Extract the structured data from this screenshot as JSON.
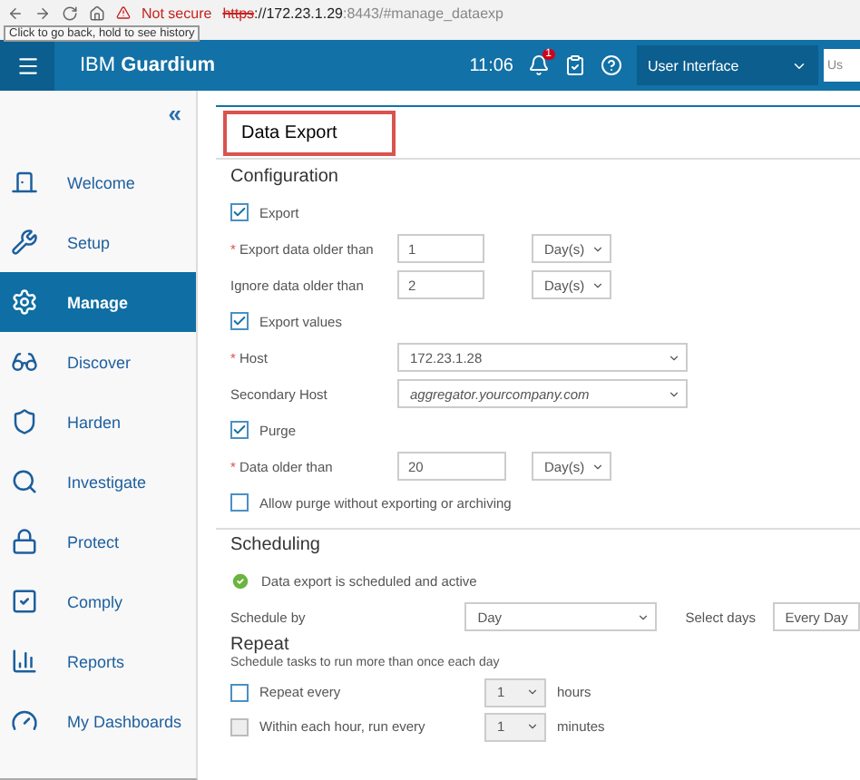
{
  "browser": {
    "warning": "Not secure",
    "url_scheme": "https",
    "url_host": "://172.23.1.29",
    "url_rest": ":8443/#manage_dataexp",
    "tooltip": "Click to go back, hold to see history"
  },
  "header": {
    "brand_prefix": "IBM",
    "brand_name": "Guardium",
    "time": "11:06",
    "notification_count": "1",
    "role_select": "User Interface",
    "search_partial": "Us"
  },
  "sidebar": {
    "collapse": "«",
    "items": [
      {
        "label": "Welcome",
        "selected": false
      },
      {
        "label": "Setup",
        "selected": false
      },
      {
        "label": "Manage",
        "selected": true
      },
      {
        "label": "Discover",
        "selected": false
      },
      {
        "label": "Harden",
        "selected": false
      },
      {
        "label": "Investigate",
        "selected": false
      },
      {
        "label": "Protect",
        "selected": false
      },
      {
        "label": "Comply",
        "selected": false
      },
      {
        "label": "Reports",
        "selected": false
      },
      {
        "label": "My Dashboards",
        "selected": false
      }
    ]
  },
  "content": {
    "title": "Data Export",
    "configuration": {
      "heading": "Configuration",
      "required_mark": "*",
      "rows": [
        {
          "kind": "checkbox",
          "label": "Export",
          "checked": true
        },
        {
          "kind": "number",
          "label": "Export data older than",
          "required": true,
          "value": "1",
          "unit": "Day(s)"
        },
        {
          "kind": "number",
          "label": "Ignore data older than",
          "required": false,
          "value": "2",
          "unit": "Day(s)"
        },
        {
          "kind": "checkbox",
          "label": "Export values",
          "checked": true
        },
        {
          "kind": "select",
          "label": "Host",
          "required": true,
          "value": "172.23.1.28"
        },
        {
          "kind": "select",
          "label": "Secondary Host",
          "required": false,
          "placeholder": "aggregator.yourcompany.com"
        },
        {
          "kind": "checkbox",
          "label": "Purge",
          "checked": true
        },
        {
          "kind": "number",
          "label": "Data older than",
          "required": true,
          "value": "20",
          "unit": "Day(s)"
        },
        {
          "kind": "checkbox",
          "label": "Allow purge without exporting or archiving",
          "checked": false
        }
      ]
    },
    "scheduling": {
      "heading": "Scheduling",
      "status": "Data export is scheduled and active",
      "schedule_by": {
        "label": "Schedule by",
        "value": "Day"
      },
      "select_days": {
        "label": "Select days",
        "value": "Every Day"
      },
      "repeat": {
        "heading": "Repeat",
        "hint": "Schedule tasks to run more than once each day",
        "rows": [
          {
            "label": "Repeat every",
            "checked": false,
            "disabled": false,
            "value": "1",
            "unit": "hours"
          },
          {
            "label": "Within each hour, run every",
            "checked": false,
            "disabled": true,
            "value": "1",
            "unit": "minutes"
          }
        ]
      }
    }
  }
}
